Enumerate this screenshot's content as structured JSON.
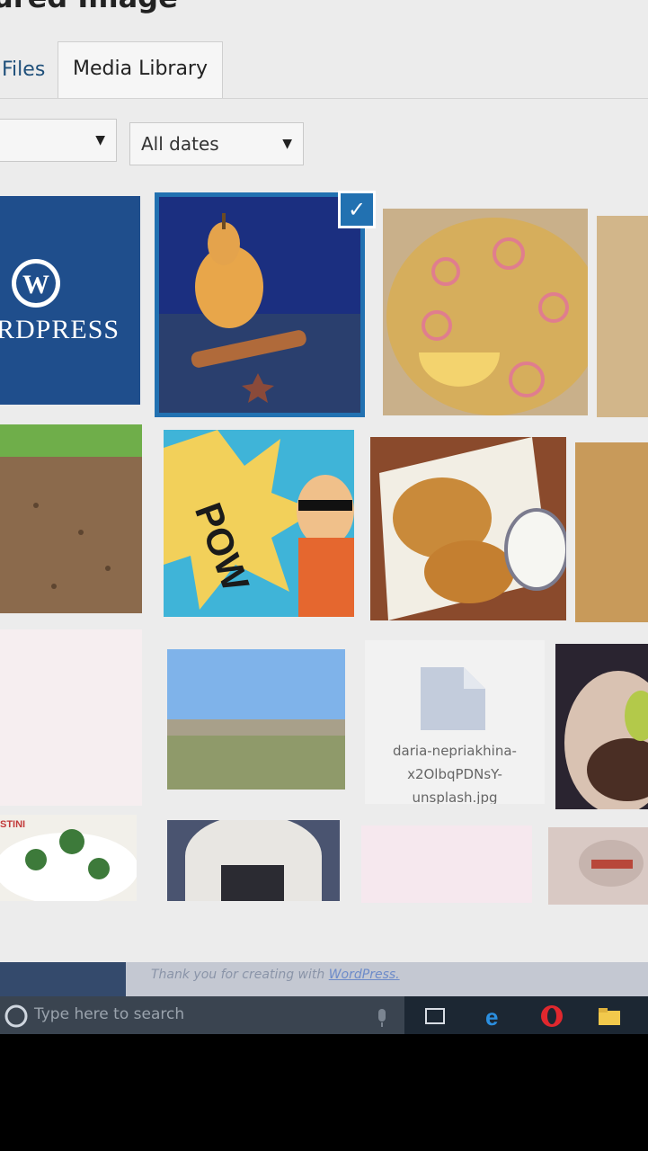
{
  "dialog": {
    "title": "ured Image",
    "tabs": [
      {
        "label": "Files",
        "active": false
      },
      {
        "label": "Media Library",
        "active": true
      }
    ]
  },
  "filters": {
    "type_filter": {
      "value": ""
    },
    "date_filter": {
      "value": "All dates"
    }
  },
  "grid": {
    "items": [
      {
        "kind": "image",
        "subject": "WordPress logo",
        "text": "RDPRESS"
      },
      {
        "kind": "image",
        "subject": "pear with cinnamon and star anise",
        "selected": true
      },
      {
        "kind": "image",
        "subject": "biryani in pan with onion rings"
      },
      {
        "kind": "image",
        "subject": "food in pan (partial)"
      },
      {
        "kind": "image",
        "subject": "ground meat dish"
      },
      {
        "kind": "image",
        "subject": "comic POW illustration",
        "text": "POW"
      },
      {
        "kind": "image",
        "subject": "fried chicken with dip"
      },
      {
        "kind": "image",
        "subject": "chicken dish (partial)"
      },
      {
        "kind": "image",
        "subject": "blank pink page"
      },
      {
        "kind": "image",
        "subject": "landscape with town"
      },
      {
        "kind": "file",
        "filename": "daria-nepriakhina-x2OlbqPDNsY-unsplash.jpg",
        "filename_lines": [
          "daria-nepriakhina-",
          "x2OlbqPDNsY-",
          "unsplash.jpg"
        ]
      },
      {
        "kind": "image",
        "subject": "plated steak"
      },
      {
        "kind": "image",
        "subject": "salad plate",
        "text": "STINI"
      },
      {
        "kind": "image",
        "subject": "architectural arch"
      },
      {
        "kind": "image",
        "subject": "pale pink image"
      },
      {
        "kind": "image",
        "subject": "glass and food"
      }
    ]
  },
  "footer": {
    "text": "Thank you for creating with ",
    "link": "WordPress."
  },
  "taskbar": {
    "search_placeholder": "Type here to search"
  },
  "colors": {
    "accent": "#2271b1",
    "wp_blue": "#1f4e8c"
  }
}
